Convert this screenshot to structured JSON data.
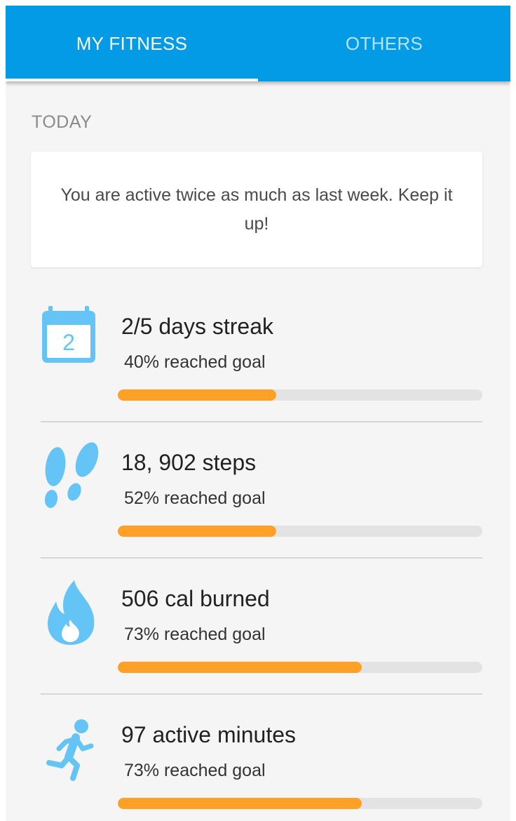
{
  "tabs": [
    {
      "label": "MY FITNESS",
      "active": true
    },
    {
      "label": "OTHERS",
      "active": false
    }
  ],
  "section": {
    "title": "TODAY"
  },
  "message": {
    "text": "You are active twice as much as last week. Keep it up!"
  },
  "stats": [
    {
      "icon": "calendar-icon",
      "calendar_day": "2",
      "title": "2/5 days streak",
      "subtitle": "40% reached goal",
      "progress_percent": 43.5
    },
    {
      "icon": "footsteps-icon",
      "title": "18, 902 steps",
      "subtitle": "52% reached goal",
      "progress_percent": 43.5
    },
    {
      "icon": "flame-icon",
      "title": "506 cal burned",
      "subtitle": "73% reached goal",
      "progress_percent": 67
    },
    {
      "icon": "running-person-icon",
      "title": "97 active minutes",
      "subtitle": "73% reached goal",
      "progress_percent": 67
    }
  ],
  "colors": {
    "app_bar": "#039be5",
    "tab_inactive_text": "#b3e5fc",
    "icon": "#64c4f5",
    "progress_fill": "#ffa126",
    "progress_track": "#e3e3e3",
    "background": "#f5f5f5"
  }
}
